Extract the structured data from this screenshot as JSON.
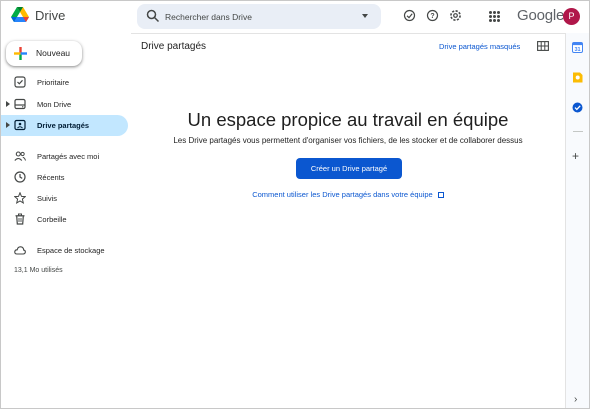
{
  "app": {
    "name": "Drive",
    "logo_colors": [
      "#0066da",
      "#00ac47",
      "#ea4335",
      "#00832d",
      "#2684fc",
      "#ffba00"
    ]
  },
  "search": {
    "placeholder": "Rechercher dans Drive"
  },
  "header": {
    "icons": [
      "offline-check-icon",
      "help-icon",
      "settings-icon",
      "apps-grid-icon"
    ],
    "google_logo_text": "Google",
    "avatar_letter": "P",
    "avatar_color": "#b0174a"
  },
  "sidebar": {
    "new_label": "Nouveau",
    "items": [
      {
        "label": "Prioritaire",
        "icon": "priority-checkbox-icon"
      },
      {
        "label": "Mon Drive",
        "icon": "my-drive-icon"
      },
      {
        "label": "Drive partagés",
        "icon": "shared-drives-icon",
        "active": true
      },
      {
        "label": "Partagés avec moi",
        "icon": "people-icon"
      },
      {
        "label": "Récents",
        "icon": "clock-icon"
      },
      {
        "label": "Suivis",
        "icon": "star-icon"
      },
      {
        "label": "Corbeille",
        "icon": "trash-icon"
      },
      {
        "label": "Espace de stockage",
        "icon": "cloud-icon"
      }
    ],
    "storage_used": "13,1 Mo utilisés"
  },
  "main": {
    "title": "Drive partagés",
    "hidden_link": "Drive partagés masqués",
    "hero_title": "Un espace propice au travail en équipe",
    "hero_desc": "Les Drive partagés vous permettent d'organiser vos fichiers, de les stocker et de collaborer dessus",
    "create_button": "Créer un Drive partagé",
    "help_link": "Comment utiliser les Drive partagés dans votre équipe"
  },
  "right_rail": {
    "icons": [
      "calendar-icon",
      "keep-icon",
      "tasks-icon",
      "add-icon",
      "chevron-right-icon"
    ],
    "accent": "#0b57d0"
  },
  "colors": {
    "active_nav_bg": "#c2e7ff",
    "primary": "#0b57d0",
    "search_bg": "#e9eef6"
  }
}
